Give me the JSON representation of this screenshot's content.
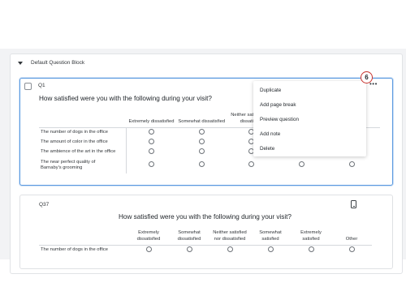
{
  "block": {
    "title": "Default Question Block"
  },
  "q1": {
    "id": "Q1",
    "text": "How satisfied were you with the following during your visit?",
    "columns": [
      "Extremely dissatisfied",
      "Somewhat dissatisfied",
      "Neither satisfied nor dissatisfied",
      "",
      "",
      ""
    ],
    "rows": [
      "The number of dogs in the office",
      "The amount of color in the office",
      "The ambience of the art in the office",
      "The near perfect quality of Barnaby's grooming"
    ]
  },
  "menu": {
    "items": [
      "Duplicate",
      "Add page break",
      "Preview question",
      "Add note",
      "Delete"
    ],
    "more_icon": "more-horizontal-icon",
    "callout_number": "6"
  },
  "q37": {
    "id": "Q37",
    "text": "How satisfied were you with the following during your visit?",
    "columns": [
      "Extremely dissatisfied",
      "Somewhat dissatisfied",
      "Neither satisfied nor dissatisfied",
      "Somewhat satisfied",
      "Extremely satisfied",
      "Other"
    ],
    "rows": [
      "The number of dogs in the office"
    ],
    "device_icon": "mobile-phone-icon"
  },
  "colors": {
    "selected_border": "#5b9ae0",
    "callout": "#c8322d"
  }
}
